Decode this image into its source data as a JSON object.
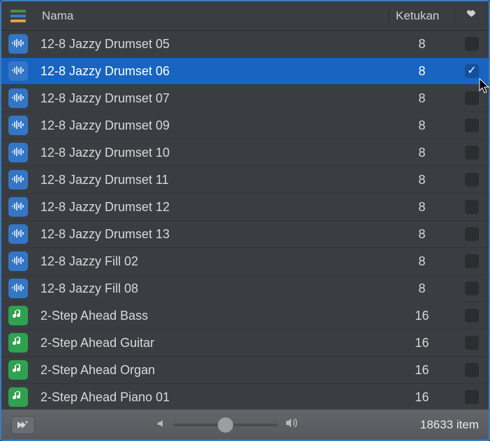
{
  "header": {
    "name_label": "Nama",
    "beats_label": "Ketukan"
  },
  "rows": [
    {
      "name": "12-8 Jazzy Drumset 05",
      "beats": "8",
      "type": "audio",
      "fav": false,
      "selected": false
    },
    {
      "name": "12-8 Jazzy Drumset 06",
      "beats": "8",
      "type": "audio",
      "fav": true,
      "selected": true
    },
    {
      "name": "12-8 Jazzy Drumset 07",
      "beats": "8",
      "type": "audio",
      "fav": false,
      "selected": false
    },
    {
      "name": "12-8 Jazzy Drumset 09",
      "beats": "8",
      "type": "audio",
      "fav": false,
      "selected": false
    },
    {
      "name": "12-8 Jazzy Drumset 10",
      "beats": "8",
      "type": "audio",
      "fav": false,
      "selected": false
    },
    {
      "name": "12-8 Jazzy Drumset 11",
      "beats": "8",
      "type": "audio",
      "fav": false,
      "selected": false
    },
    {
      "name": "12-8 Jazzy Drumset 12",
      "beats": "8",
      "type": "audio",
      "fav": false,
      "selected": false
    },
    {
      "name": "12-8 Jazzy Drumset 13",
      "beats": "8",
      "type": "audio",
      "fav": false,
      "selected": false
    },
    {
      "name": "12-8 Jazzy Fill 02",
      "beats": "8",
      "type": "audio",
      "fav": false,
      "selected": false
    },
    {
      "name": "12-8 Jazzy Fill 08",
      "beats": "8",
      "type": "audio",
      "fav": false,
      "selected": false
    },
    {
      "name": "2-Step Ahead Bass",
      "beats": "16",
      "type": "midi",
      "fav": false,
      "selected": false
    },
    {
      "name": "2-Step Ahead Guitar",
      "beats": "16",
      "type": "midi",
      "fav": false,
      "selected": false
    },
    {
      "name": "2-Step Ahead Organ",
      "beats": "16",
      "type": "midi",
      "fav": false,
      "selected": false
    },
    {
      "name": "2-Step Ahead Piano 01",
      "beats": "16",
      "type": "midi",
      "fav": false,
      "selected": false
    }
  ],
  "footer": {
    "item_count": "18633 item"
  }
}
